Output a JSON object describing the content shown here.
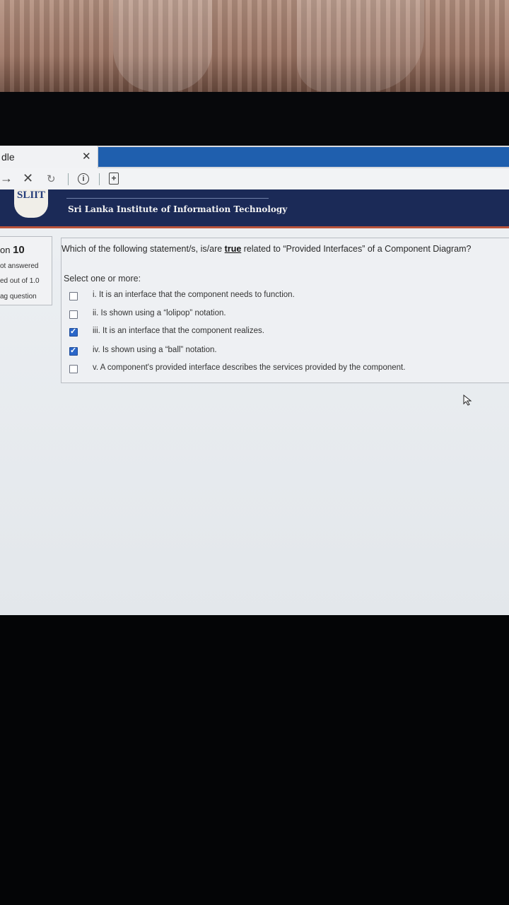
{
  "browser": {
    "tab_title": "dle",
    "tab_close": "✕",
    "nav": {
      "forward": "→",
      "stop": "✕",
      "reload": "↻",
      "info": "i",
      "doc": "+"
    }
  },
  "banner": {
    "logo_text": "SLIIT",
    "institution": "Sri Lanka Institute of Information Technology"
  },
  "question_info": {
    "label_prefix": "on",
    "number": "10",
    "status": "ot answered",
    "marks": "ed out of 1.0",
    "flag": "ag question"
  },
  "question": {
    "text_before": "Which of the following statement/s, is/are ",
    "text_emph": "true",
    "text_after": " related to “Provided Interfaces” of a Component Diagram?",
    "select_label": "Select one or more:",
    "options": [
      {
        "label": "i. It is an interface that the component needs to function.",
        "checked": false
      },
      {
        "label": "ii. Is shown using a “lolipop” notation.",
        "checked": false
      },
      {
        "label": "iii. It is an interface that the component realizes.",
        "checked": true
      },
      {
        "label": "iv. Is shown using a “ball” notation.",
        "checked": true
      },
      {
        "label": "v. A component's provided interface describes the services provided by the component.",
        "checked": false
      }
    ]
  }
}
